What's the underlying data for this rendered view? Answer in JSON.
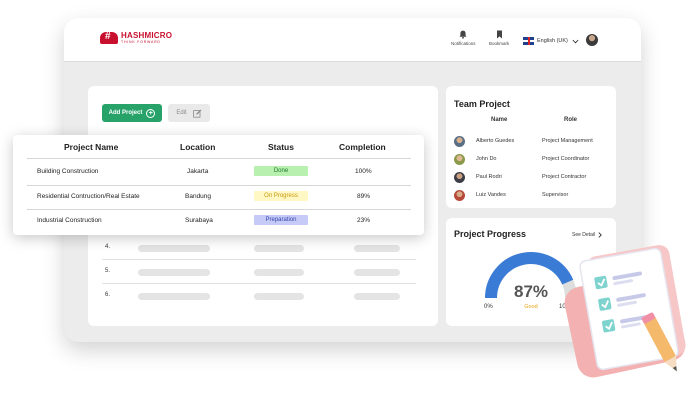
{
  "brand": {
    "name": "HASHMICRO",
    "tagline": "THINK FORWARD"
  },
  "header": {
    "notifications_label": "Notifications",
    "bookmark_label": "Bookmark",
    "language": "English (UK)"
  },
  "toolbar": {
    "add_label": "Add Project",
    "edit_label": "Edit"
  },
  "projects_table": {
    "columns": [
      "Project Name",
      "Location",
      "Status",
      "Completion"
    ],
    "rows": [
      {
        "name": "Building Construction",
        "location": "Jakarta",
        "status": "Done",
        "completion": "100%"
      },
      {
        "name": "Residential Contruction/Real Estate",
        "location": "Bandung",
        "status": "On Progress",
        "completion": "89%"
      },
      {
        "name": "Industrial Construction",
        "location": "Surabaya",
        "status": "Preparation",
        "completion": "23%"
      }
    ],
    "placeholder_rows": [
      "4.",
      "5.",
      "6."
    ]
  },
  "team": {
    "title": "Team Project",
    "columns": [
      "Name",
      "Role"
    ],
    "members": [
      {
        "name": "Alberto Guedes",
        "role": "Project Management"
      },
      {
        "name": "John Do",
        "role": "Project Coordinator"
      },
      {
        "name": "Paul Rodri",
        "role": "Project Contractor"
      },
      {
        "name": "Luiz Vandes",
        "role": "Supervisor"
      }
    ]
  },
  "progress": {
    "title": "Project Progress",
    "see_detail": "See Detail",
    "value": "87%",
    "fraction": 0.87,
    "status": "Good",
    "min": "0%",
    "max": "100%"
  },
  "colors": {
    "brand": "#c8102e",
    "primary_button": "#27a36a",
    "gauge_fill": "#3a7bd5",
    "gauge_track": "#dedede",
    "status_done": "#b8f0b0",
    "status_progress": "#fff7c4",
    "status_preparation": "#c5cbf6"
  },
  "icons": [
    "bell-icon",
    "bookmark-icon",
    "uk-flag-icon",
    "chevron-down-icon",
    "plus-circle-icon",
    "edit-icon",
    "chevron-right-icon",
    "clipboard-checklist-icon",
    "pencil-icon"
  ]
}
